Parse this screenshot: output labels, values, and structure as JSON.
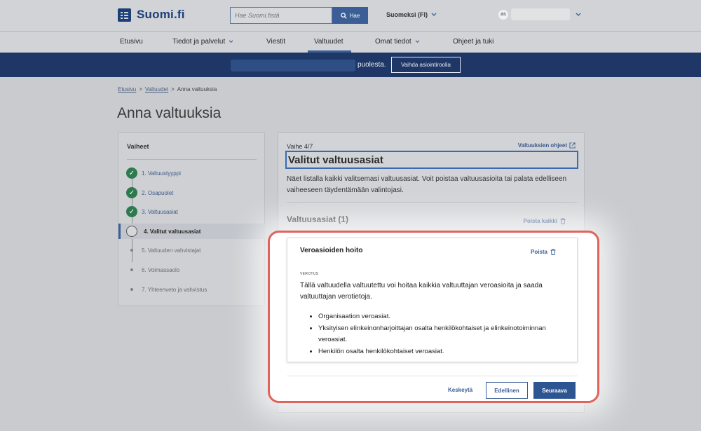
{
  "header": {
    "logo_text": "Suomi.fi",
    "search_placeholder": "Hae Suomi.fistä",
    "search_button": "Hae",
    "language": "Suomeksi (FI)",
    "user_initials": "as"
  },
  "nav": {
    "items": [
      {
        "label": "Etusivu",
        "has_menu": false
      },
      {
        "label": "Tiedot ja palvelut",
        "has_menu": true
      },
      {
        "label": "Viestit",
        "has_menu": false
      },
      {
        "label": "Valtuudet",
        "has_menu": false,
        "active": true
      },
      {
        "label": "Omat tiedot",
        "has_menu": true
      },
      {
        "label": "Ohjeet ja tuki",
        "has_menu": false
      }
    ]
  },
  "role_bar": {
    "suffix": "puolesta.",
    "switch_button": "Vaihda asiointiroolia"
  },
  "breadcrumb": {
    "home": "Etusivu",
    "sep": ">",
    "parent": "Valtuudet",
    "current": "Anna valtuuksia"
  },
  "page_title": "Anna valtuuksia",
  "steps": {
    "title": "Vaiheet",
    "items": [
      {
        "label": "1. Valtuustyyppi",
        "state": "done"
      },
      {
        "label": "2. Osapuolet",
        "state": "done"
      },
      {
        "label": "3. Valtuusasiat",
        "state": "done"
      },
      {
        "label": "4. Valitut valtuusasiat",
        "state": "current"
      },
      {
        "label": "5. Valtuuden vahvistajat",
        "state": "todo"
      },
      {
        "label": "6. Voimassaolo",
        "state": "todo"
      },
      {
        "label": "7. Yhteenveto ja vahvistus",
        "state": "todo"
      }
    ]
  },
  "main": {
    "phase": "Vaihe 4/7",
    "help_link": "Valtuuksien ohjeet",
    "section_title": "Valitut valtuusasiat",
    "intro": "Näet listalla kaikki valitsemasi valtuusasiat. Voit poistaa valtuusasioita tai palata edelliseen vaiheeseen täydentämään valintojasi.",
    "list_title": "Valtuusasiat (1)",
    "remove_all": "Poista kaikki",
    "item": {
      "title": "Veroasioiden hoito",
      "remove": "Poista",
      "category": "VEROTUS",
      "description": "Tällä valtuudella valtuutettu voi hoitaa kaikkia valtuuttajan veroasioita ja saada valtuuttajan verotietoja.",
      "bullets": [
        "Organisaation veroasiat.",
        "Yksityisen elinkeinonharjoittajan osalta henkilökohtaiset ja elinkeinotoiminnan veroasiat.",
        "Henkilön osalta henkilökohtaiset veroasiat."
      ]
    },
    "buttons": {
      "cancel": "Keskeytä",
      "previous": "Edellinen",
      "next": "Seuraava"
    }
  },
  "colors": {
    "brand": "#1c3f78",
    "primary_button": "#2d5592",
    "success": "#2c7a4e",
    "highlight_border": "#e0635c"
  }
}
